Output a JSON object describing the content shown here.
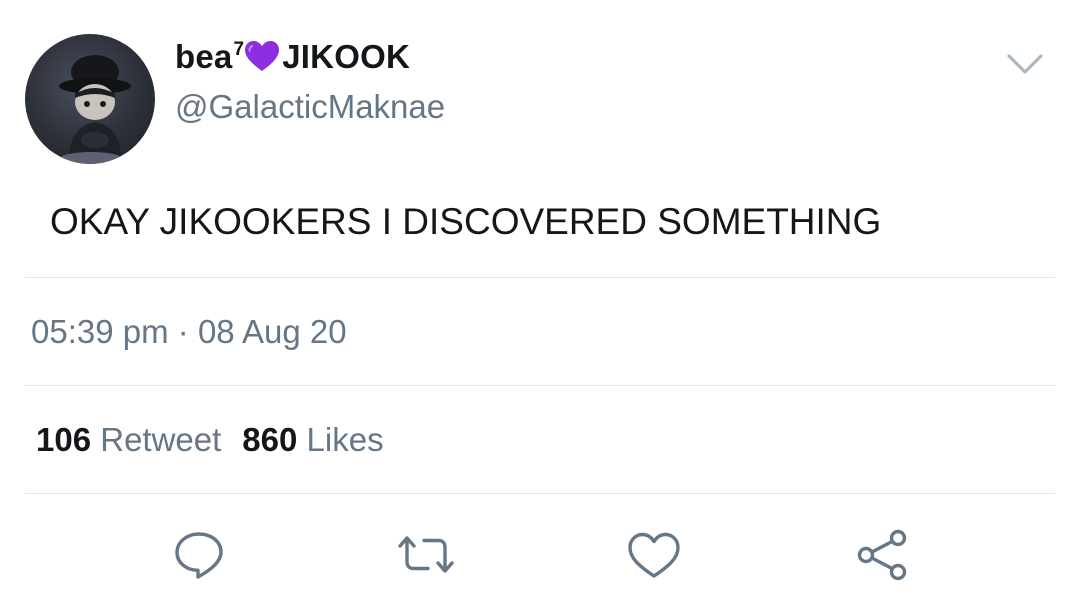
{
  "tweet": {
    "display_name_before": "bea",
    "display_name_sup": "7",
    "display_name_after": "JIKOOK",
    "heart_emoji": "purple-heart",
    "handle": "@GalacticMaknae",
    "text": "OKAY JIKOOKERS I DISCOVERED SOMETHING",
    "time": "05:39 pm",
    "separator": "·",
    "date": "08 Aug 20",
    "retweet_count": "106",
    "retweet_label": "Retweet",
    "like_count": "860",
    "like_label": "Likes"
  },
  "colors": {
    "text_primary": "#14171a",
    "text_secondary": "#657786",
    "divider": "#e1e8ed",
    "icon": "#657786",
    "heart_purple": "#8e2de2"
  },
  "icons": {
    "more": "chevron-down-icon",
    "reply": "reply-icon",
    "retweet": "retweet-icon",
    "like": "heart-icon",
    "share": "share-icon"
  }
}
